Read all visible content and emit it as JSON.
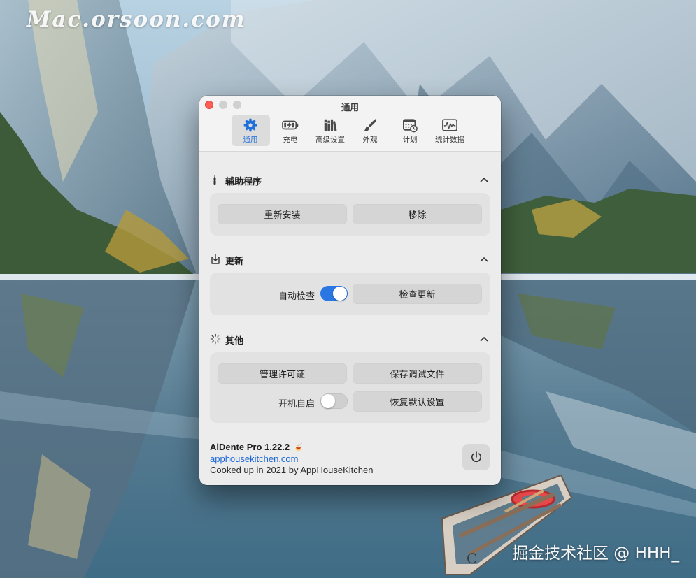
{
  "watermark": {
    "top_left": "Mac.orsoon.com",
    "bottom_right": "掘金技术社区 @ HHH_"
  },
  "window": {
    "title": "通用",
    "traffic_lights": [
      "close",
      "minimize",
      "zoom"
    ]
  },
  "toolbar": {
    "tabs": [
      {
        "label": "通用",
        "icon": "gear-icon",
        "active": true
      },
      {
        "label": "充电",
        "icon": "battery-icon",
        "active": false
      },
      {
        "label": "高级设置",
        "icon": "books-icon",
        "active": false
      },
      {
        "label": "外观",
        "icon": "brush-icon",
        "active": false
      },
      {
        "label": "计划",
        "icon": "calendar-clock-icon",
        "active": false
      },
      {
        "label": "统计数据",
        "icon": "chart-icon",
        "active": false
      }
    ]
  },
  "sections": {
    "helper": {
      "title": "辅助程序",
      "icon": "wrench-icon",
      "reinstall_label": "重新安装",
      "remove_label": "移除"
    },
    "update": {
      "title": "更新",
      "icon": "download-box-icon",
      "auto_check_label": "自动检查",
      "auto_check_on": true,
      "check_label": "检查更新"
    },
    "other": {
      "title": "其他",
      "icon": "spinner-icon",
      "license_label": "管理许可证",
      "save_debug_label": "保存调试文件",
      "launch_at_login_label": "开机自启",
      "launch_at_login_on": false,
      "restore_defaults_label": "恢复默认设置"
    }
  },
  "footer": {
    "app_name": "AlDente Pro 1.22.2",
    "app_emoji": "🍝",
    "link": "apphousekitchen.com",
    "credit": "Cooked up in 2021 by AppHouseKitchen"
  },
  "colors": {
    "accent": "#2a77e3",
    "close_button": "#fe5f57",
    "link": "#1a66d6"
  }
}
